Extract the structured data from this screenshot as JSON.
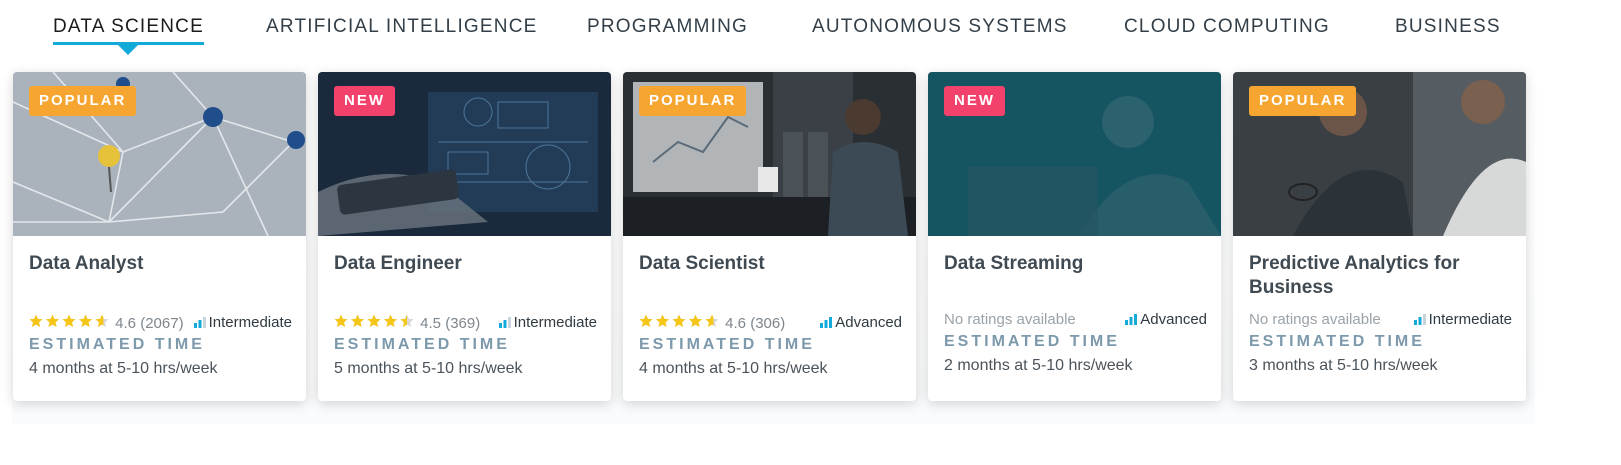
{
  "tabs": [
    {
      "label": "DATA SCIENCE",
      "active": true
    },
    {
      "label": "ARTIFICIAL INTELLIGENCE"
    },
    {
      "label": "PROGRAMMING"
    },
    {
      "label": "AUTONOMOUS SYSTEMS"
    },
    {
      "label": "CLOUD COMPUTING"
    },
    {
      "label": "BUSINESS"
    }
  ],
  "colors": {
    "accent": "#13a9d8",
    "popular_badge": "#f7a531",
    "new_badge": "#f2416b",
    "star": "#f5c518"
  },
  "cards": [
    {
      "badge": "POPULAR",
      "title": "Data Analyst",
      "rating": "4.6",
      "rating_count": "(2067)",
      "stars": 4.6,
      "level": "Intermediate",
      "level_icon": "bar-chart-icon",
      "estimated_label": "ESTIMATED TIME",
      "estimated_value": "4 months at 5-10 hrs/week"
    },
    {
      "badge": "NEW",
      "title": "Data Engineer",
      "rating": "4.5",
      "rating_count": "(369)",
      "stars": 4.5,
      "level": "Intermediate",
      "level_icon": "bar-chart-icon",
      "estimated_label": "ESTIMATED TIME",
      "estimated_value": "5 months at 5-10 hrs/week"
    },
    {
      "badge": "POPULAR",
      "title": "Data Scientist",
      "rating": "4.6",
      "rating_count": "(306)",
      "stars": 4.6,
      "level": "Advanced",
      "level_icon": "bar-chart-icon",
      "estimated_label": "ESTIMATED TIME",
      "estimated_value": "4 months at 5-10 hrs/week"
    },
    {
      "badge": "NEW",
      "title": "Data Streaming",
      "no_ratings": "No ratings available",
      "level": "Advanced",
      "level_icon": "bar-chart-icon",
      "estimated_label": "ESTIMATED TIME",
      "estimated_value": "2 months at 5-10 hrs/week"
    },
    {
      "badge": "POPULAR",
      "title": "Predictive Analytics for Business",
      "no_ratings": "No ratings available",
      "level": "Intermediate",
      "level_icon": "bar-chart-icon",
      "estimated_label": "ESTIMATED TIME",
      "estimated_value": "3 months at 5-10 hrs/week"
    }
  ]
}
